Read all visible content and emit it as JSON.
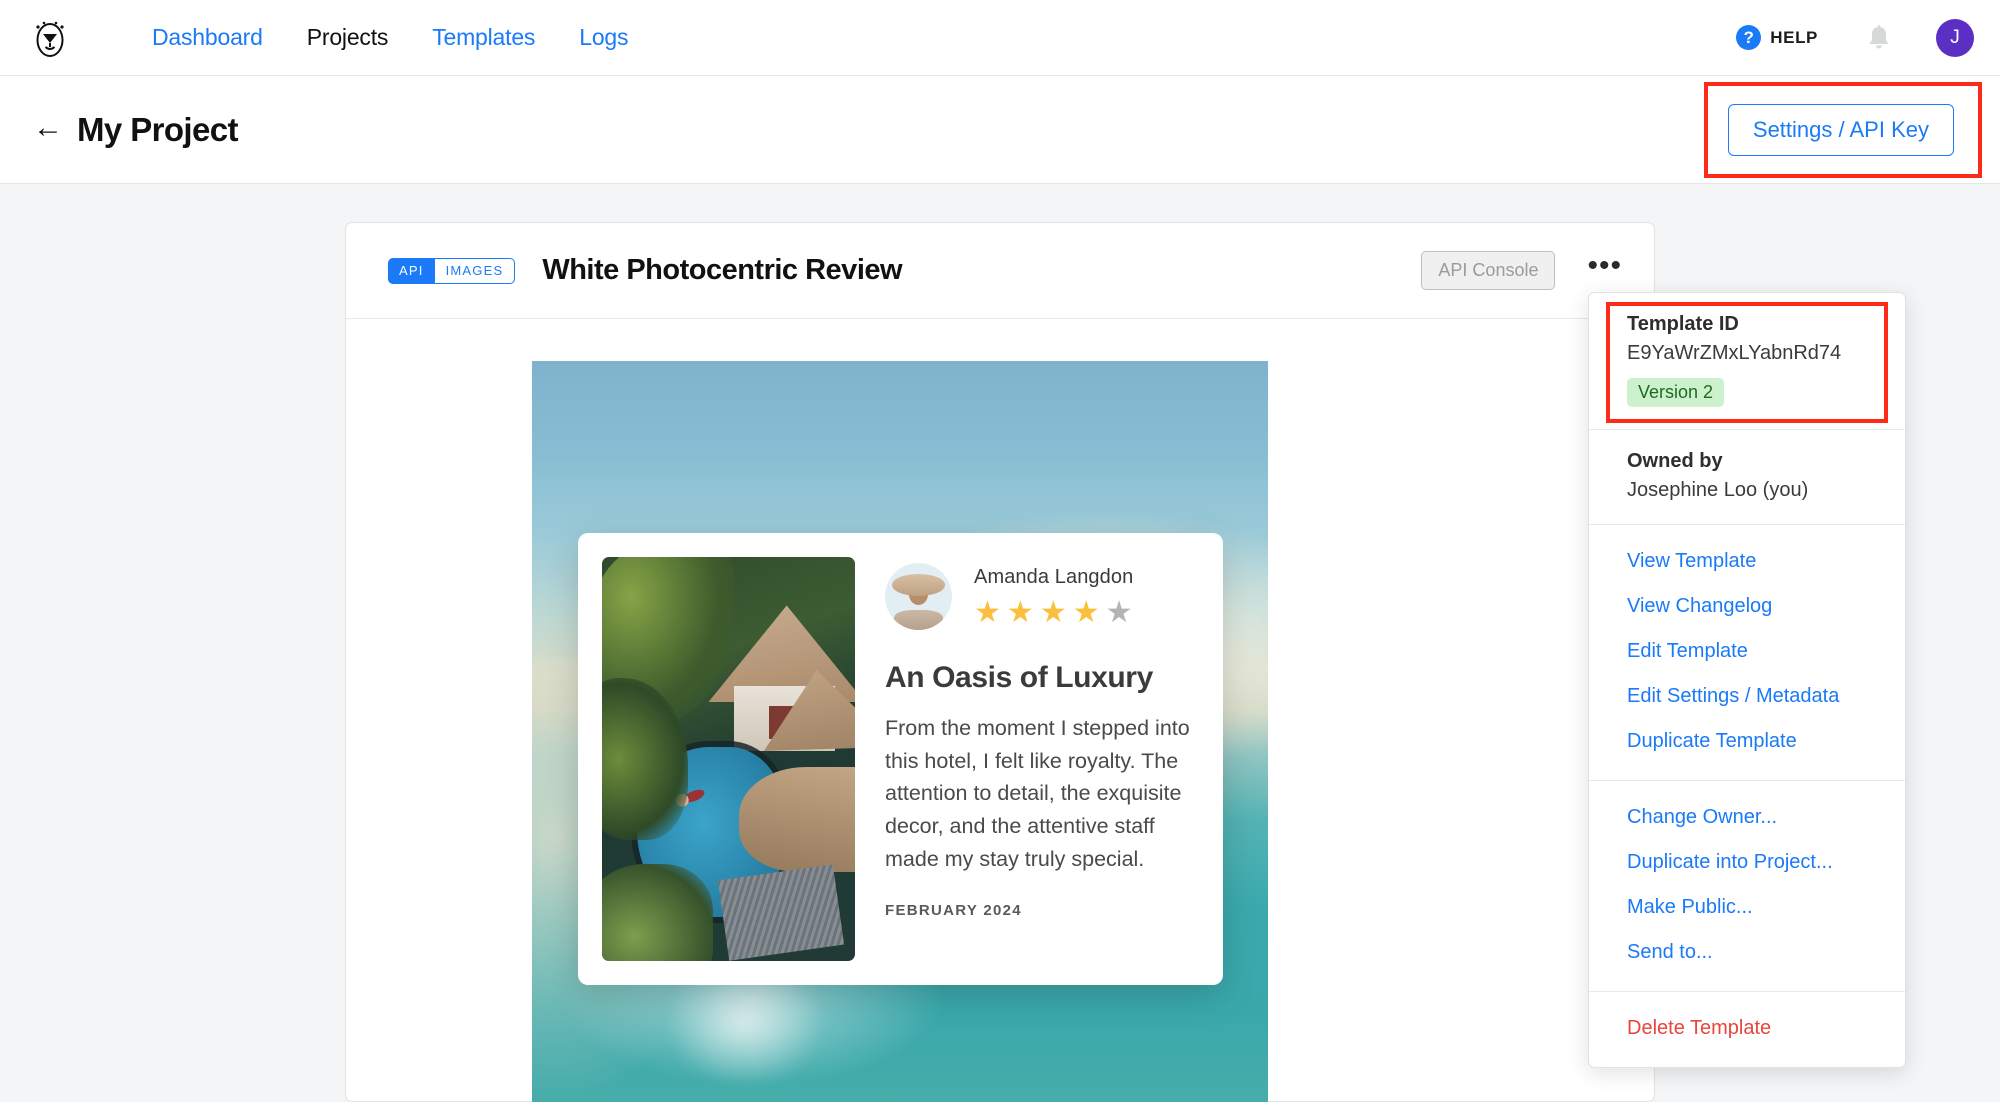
{
  "nav": {
    "logo_icon": "egg-mascot-logo",
    "links": [
      {
        "label": "Dashboard",
        "active": false
      },
      {
        "label": "Projects",
        "active": true
      },
      {
        "label": "Templates",
        "active": false
      },
      {
        "label": "Logs",
        "active": false
      }
    ],
    "help_label": "HELP",
    "help_icon": "question-mark-circle-icon",
    "bell_icon": "notification-bell-icon",
    "avatar_initial": "J"
  },
  "project_header": {
    "back_arrow": "←",
    "title": "My Project",
    "settings_button": "Settings / API Key"
  },
  "card": {
    "badge_api": "API",
    "badge_images": "IMAGES",
    "title": "White Photocentric Review",
    "api_console_label": "API Console",
    "more_icon": "•••"
  },
  "review": {
    "reviewer_name": "Amanda Langdon",
    "rating": 4,
    "rating_max": 5,
    "title": "An Oasis of Luxury",
    "body": "From the moment I stepped into this hotel, I felt like royalty. The attention to detail, the exquisite decor, and the attentive staff made my stay truly special.",
    "date": "FEBRUARY 2024"
  },
  "menu": {
    "template_id_label": "Template ID",
    "template_id_value": "E9YaWrZMxLYabnRd74",
    "version_badge": "Version 2",
    "owned_by_label": "Owned by",
    "owned_by_value": "Josephine Loo (you)",
    "items_group_1": [
      "View Template",
      "View Changelog",
      "Edit Template",
      "Edit Settings / Metadata",
      "Duplicate Template"
    ],
    "items_group_2": [
      "Change Owner...",
      "Duplicate into Project...",
      "Make Public...",
      "Send to..."
    ],
    "delete_label": "Delete Template"
  },
  "colors": {
    "accent_blue": "#1a7af8",
    "danger_red": "#e8453c",
    "annotation_red": "#ff2b19",
    "avatar_purple": "#5b2ec4",
    "version_green_bg": "#cdf0cd",
    "version_green_text": "#1d6c1d",
    "star_gold": "#fbbf3e",
    "star_gray": "#b4b4b4",
    "page_bg": "#f4f5f6"
  }
}
